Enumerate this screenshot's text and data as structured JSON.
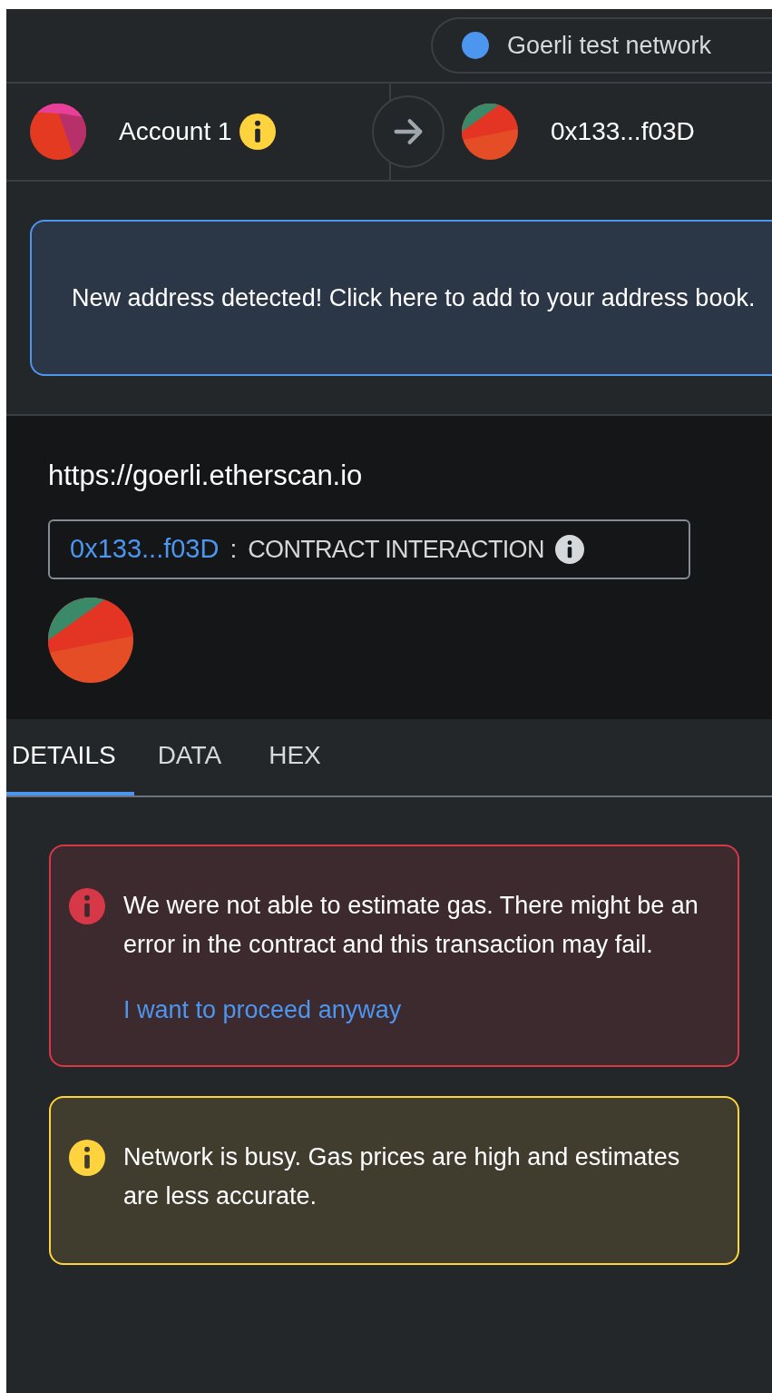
{
  "network": {
    "name": "Goerli test network"
  },
  "sender": {
    "name": "Account 1"
  },
  "recipient": {
    "address": "0x133...f03D"
  },
  "address_notice": "New address detected! Click here to add to your address book.",
  "origin": "https://goerli.etherscan.io",
  "contract": {
    "address": "0x133...f03D",
    "separator": ":",
    "label": "CONTRACT INTERACTION"
  },
  "tabs": [
    {
      "label": "DETAILS",
      "selected": true
    },
    {
      "label": "DATA",
      "selected": false
    },
    {
      "label": "HEX",
      "selected": false
    }
  ],
  "alerts": [
    {
      "kind": "danger",
      "message": "We were not able to estimate gas. There might be an error in the contract and this transaction may fail.",
      "link": "I want to proceed anyway"
    },
    {
      "kind": "warning",
      "message": "Network is busy. Gas prices are high and estimates are less accurate."
    }
  ]
}
